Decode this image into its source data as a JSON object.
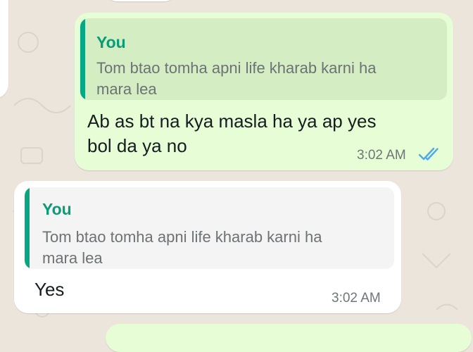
{
  "colors": {
    "chat_background": "#ece5dc",
    "outgoing_bubble": "#e7fdd6",
    "incoming_bubble": "#ffffff",
    "quote_accent": "#06a884",
    "read_ticks": "#4fa8f0"
  },
  "messages": [
    {
      "direction": "outgoing",
      "quote": {
        "sender": "You",
        "text": "Tom btao tomha apni life kharab karni ha\nmara lea"
      },
      "text": "Ab as bt na kya masla ha  ya ap yes\nbol da ya no",
      "time": "3:02 AM",
      "status_icon": "double-check-read-icon"
    },
    {
      "direction": "incoming",
      "quote": {
        "sender": "You",
        "text": "Tom btao tomha apni life kharab karni ha\nmara lea"
      },
      "text": "Yes",
      "time": "3:02 AM"
    }
  ]
}
